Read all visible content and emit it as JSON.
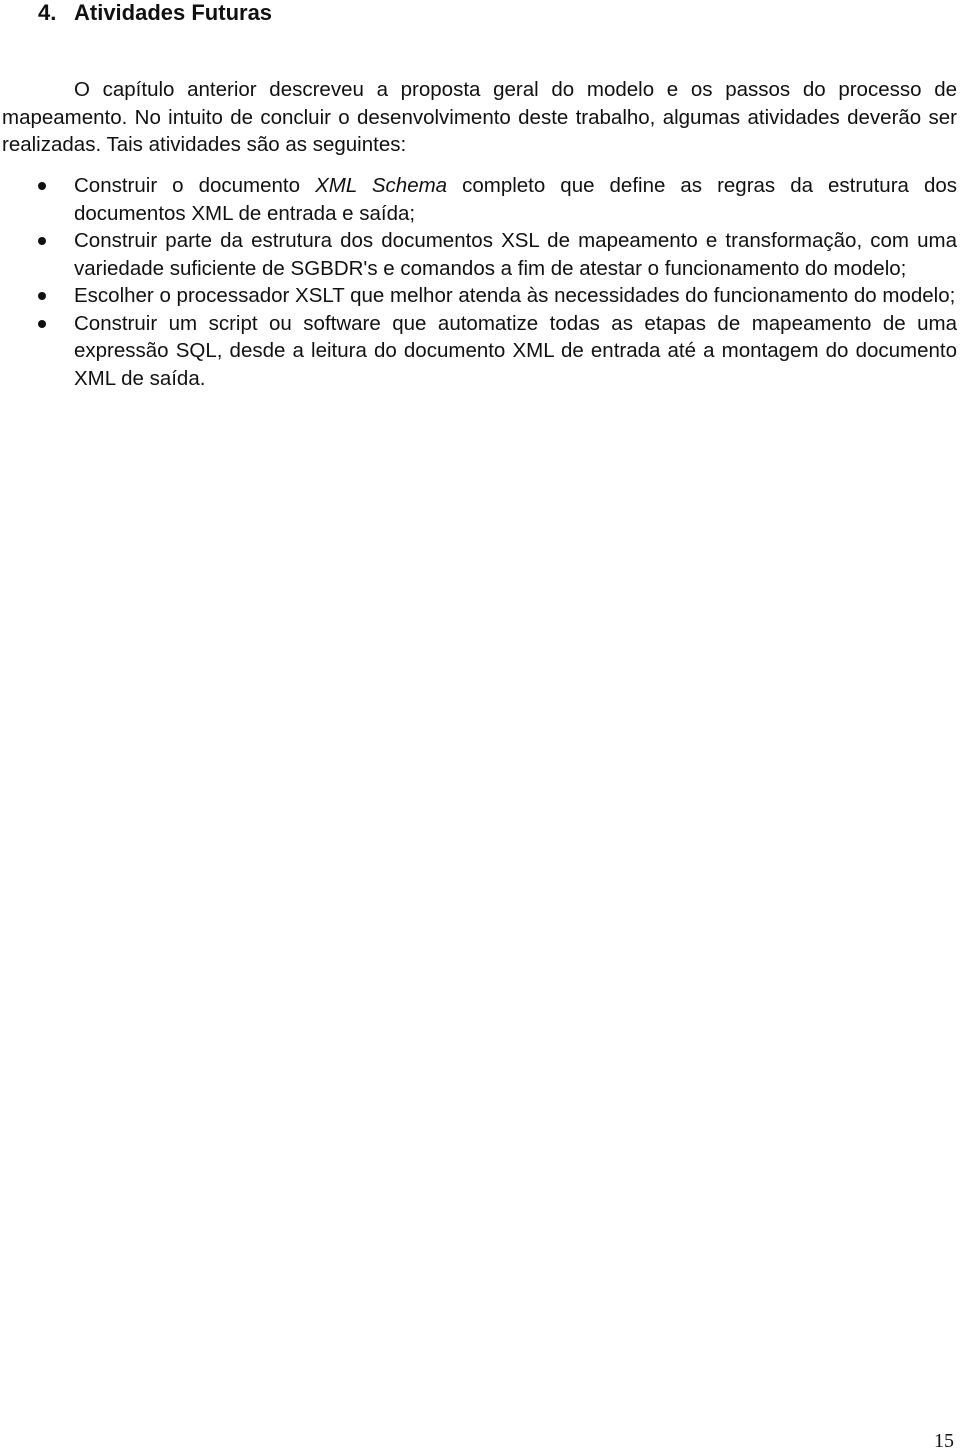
{
  "section": {
    "number": "4.",
    "title": "Atividades Futuras"
  },
  "intro_paragraph": "O capítulo anterior descreveu a proposta geral do modelo e os passos do processo de mapeamento. No intuito de concluir o desenvolvimento deste trabalho, algumas atividades deverão ser realizadas. Tais atividades são as seguintes:",
  "list_items": [
    {
      "before_italic": "Construir o documento ",
      "italic": "XML Schema",
      "after_italic": " completo que define as regras da estrutura dos documentos XML de entrada e saída;"
    },
    {
      "text": "Construir parte da estrutura dos documentos XSL de mapeamento e transformação, com uma variedade suficiente de SGBDR's e comandos a fim de atestar o funcionamento do modelo;"
    },
    {
      "text": "Escolher o processador XSLT que melhor atenda às necessidades do funcionamento  do modelo;"
    },
    {
      "text": "Construir um script ou software que automatize todas as etapas de mapeamento de uma expressão SQL, desde a leitura do documento XML de entrada até a montagem do documento XML de saída."
    }
  ],
  "page_number": "15"
}
